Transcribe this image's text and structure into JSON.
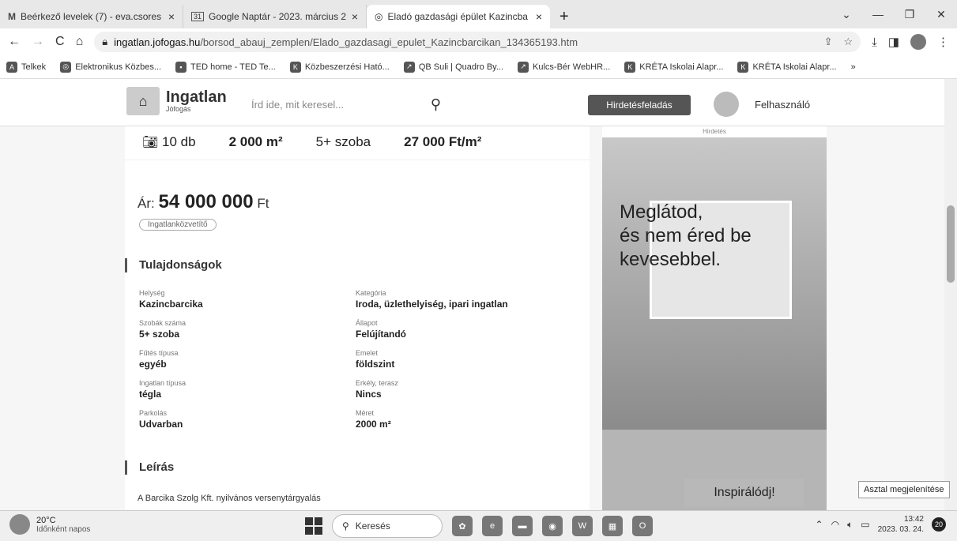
{
  "browser": {
    "tabs": [
      {
        "icon": "M",
        "title": "Beérkező levelek (7) - eva.csores"
      },
      {
        "icon": "31",
        "title": "Google Naptár - 2023. március 2"
      },
      {
        "icon": "◎",
        "title": "Eladó gazdasági épület Kazincba"
      }
    ],
    "url_host": "ingatlan.jofogas.hu",
    "url_path": "/borsod_abauj_zemplen/Elado_gazdasagi_epulet_Kazincbarcikan_134365193.htm",
    "bookmarks": [
      "Telkek",
      "Elektronikus Közbes...",
      "TED home - TED Te...",
      "Közbeszerzési Ható...",
      "QB Suli | Quadro By...",
      "Kulcs-Bér WebHR...",
      "KRÉTA Iskolai Alapr...",
      "KRÉTA Iskolai Alapr..."
    ],
    "bookmarks_more": "»"
  },
  "header": {
    "logo_name": "Ingatlan",
    "logo_sub": "Jófogás",
    "search_placeholder": "Írd ide, mit keresel...",
    "post_button": "Hirdetésfeladás",
    "user_label": "Felhasználó"
  },
  "stats": {
    "photos": "10 db",
    "area": "2 000 m²",
    "rooms": "5+ szoba",
    "price_per_m2": "27 000 Ft/m²"
  },
  "price": {
    "label": "Ár:",
    "value": "54 000 000",
    "currency": "Ft"
  },
  "badge": "Ingatlanközvetítő",
  "properties_title": "Tulajdonságok",
  "properties": [
    {
      "label": "Helység",
      "value": "Kazincbarcika"
    },
    {
      "label": "Kategória",
      "value": "Iroda, üzlethelyiség, ipari ingatlan"
    },
    {
      "label": "Szobák száma",
      "value": "5+ szoba"
    },
    {
      "label": "Állapot",
      "value": "Felújítandó"
    },
    {
      "label": "Fűtés típusa",
      "value": "egyéb"
    },
    {
      "label": "Emelet",
      "value": "földszint"
    },
    {
      "label": "Ingatlan típusa",
      "value": "tégla"
    },
    {
      "label": "Erkély, terasz",
      "value": "Nincs"
    },
    {
      "label": "Parkolás",
      "value": "Udvarban"
    },
    {
      "label": "Méret",
      "value": "2000 m²"
    }
  ],
  "description_title": "Leírás",
  "description_text": "A Barcika Szolg Kft. nyilvános versenytárgyalás",
  "ad": {
    "label": "Hirdetés",
    "text": "Meglátod,\nés nem éred be\nkevesebbel.",
    "button": "Inspirálódj!"
  },
  "tooltip": "Asztal megjelenítése",
  "taskbar": {
    "temp": "20°C",
    "weather": "Időnként napos",
    "search": "Keresés",
    "time": "13:42",
    "date": "2023. 03. 24.",
    "notifications": "20"
  }
}
